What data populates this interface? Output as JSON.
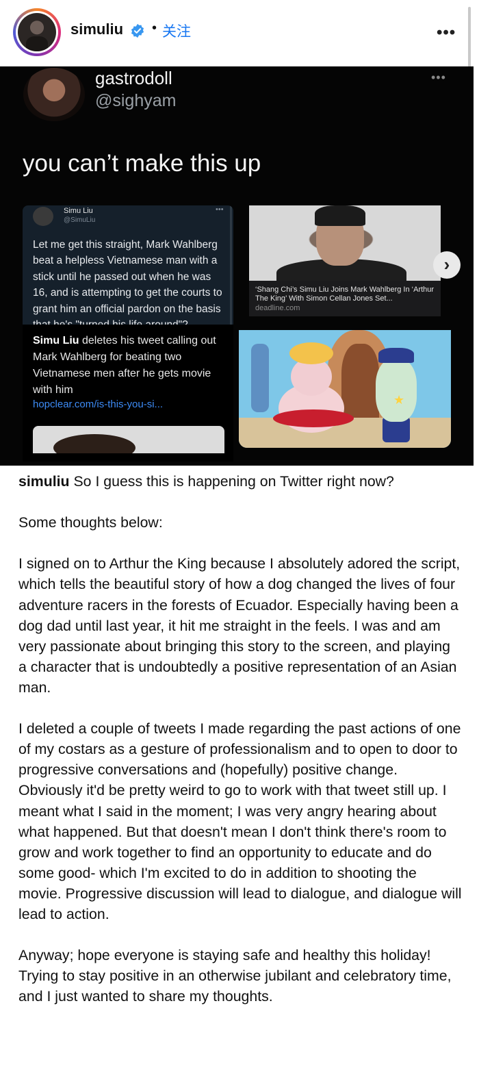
{
  "header": {
    "username": "simuliu",
    "separator": "•",
    "follow_label": "关注",
    "more_label": "•••",
    "verified_color": "#3897f0"
  },
  "post_image": {
    "tweet": {
      "display_name": "gastrodoll",
      "handle": "@sighyam",
      "more_label": "•••",
      "text": "you can’t make this up"
    },
    "quoted_tweet": {
      "display_name": "Simu Liu",
      "handle": "@SimuLiu",
      "more_label": "•••",
      "text": "Let me get this straight, Mark Wahlberg beat a helpless Vietnamese man with a stick until he passed out when he was 16, and is attempting to get the courts to grant him an official pardon on the basis that he's \"turned his life around\"?"
    },
    "link_card_deadline": {
      "title": "‘Shang Chi’s Simu Liu Joins Mark Wahlberg In ‘Arthur The King’ With Simon Cellan Jones Set...",
      "domain": "deadline.com"
    },
    "link_card_hopclear": {
      "title_bold": "Simu Liu",
      "title_rest": " deletes his tweet calling out Mark Wahlberg for beating two Vietnamese men after he gets movie with him",
      "url": "hopclear.com/is-this-you-si..."
    },
    "next_label": "›"
  },
  "caption": {
    "author": "simuliu",
    "first_line": " So I guess this is happening on Twitter right now?",
    "paragraphs": [
      "Some thoughts below:",
      "I signed on to Arthur the King because I absolutely adored the script, which tells the beautiful story of how a dog changed the lives of four adventure racers in the forests of Ecuador. Especially having been a dog dad until last year, it hit me straight in the feels. I was and am very passionate about bringing this story to the screen, and playing a character that is undoubtedly a positive representation of an Asian man.",
      "I deleted a couple of tweets I made regarding the past actions of one of my costars as a gesture of professionalism and to open to door to progressive conversations and (hopefully) positive change. Obviously it'd be pretty weird to go to work with that tweet still up. I meant what I said in the moment; I was very angry hearing about what happened. But that doesn't mean I don't think there's room to grow and work together to find an opportunity to educate and do some good- which I'm excited to do in addition to shooting the movie. Progressive discussion will lead to dialogue, and dialogue will lead to action.",
      "Anyway; hope everyone is staying safe and healthy this holiday! Trying to stay positive in an otherwise jubilant and celebratory time, and I just wanted to share my thoughts."
    ]
  }
}
